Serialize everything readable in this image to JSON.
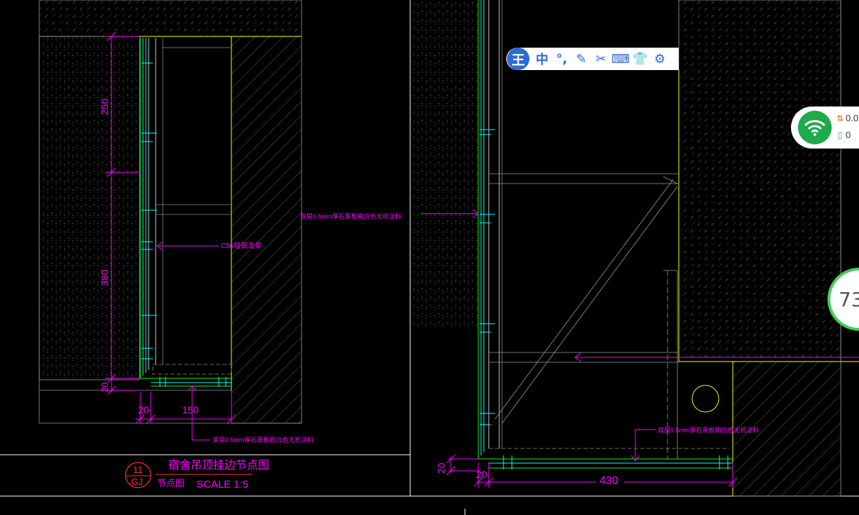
{
  "left_detail": {
    "dims": {
      "d1": "250",
      "d2": "380",
      "d3": "20",
      "d4": "20",
      "d5": "150"
    },
    "note_board": "双层9.5mm厚石膏板刷白色无机涂料",
    "note_keel": "C50轻钢龙骨",
    "note_bottom": "双层9.5mm厚石膏板刷白色无机涂料"
  },
  "title_block": {
    "badge_top": "11",
    "badge_bottom": "GJ",
    "title": "宿舍吊顶挂边节点图",
    "subtitle": "节点图",
    "scale": "SCALE 1:5"
  },
  "right_detail": {
    "dims": {
      "d1": "20",
      "d2": "20",
      "d3": "430"
    },
    "note_board": "双层9.5mm厚石膏板刷白色无机涂料"
  },
  "ime_toolbar": {
    "logo": "王",
    "items": [
      {
        "label": "中",
        "icon": "chinese-mode-icon"
      },
      {
        "label": "°,",
        "icon": "punctuation-icon"
      },
      {
        "label": "✎",
        "icon": "handwriting-icon"
      },
      {
        "label": "✂",
        "icon": "scissors-icon"
      },
      {
        "label": "⌨",
        "icon": "keyboard-icon"
      },
      {
        "label": "👕",
        "icon": "skin-icon"
      },
      {
        "label": "⚙",
        "icon": "gear-icon"
      }
    ]
  },
  "network_widget": {
    "upload": "0.0",
    "download": "0"
  },
  "speed_ball": {
    "value": "73"
  },
  "colors": {
    "magenta": "#ff00ff",
    "yellow": "#ffff00",
    "cyan": "#00ffff",
    "green": "#00ff00",
    "white": "#ffffff",
    "gray": "#8a8a8a"
  }
}
